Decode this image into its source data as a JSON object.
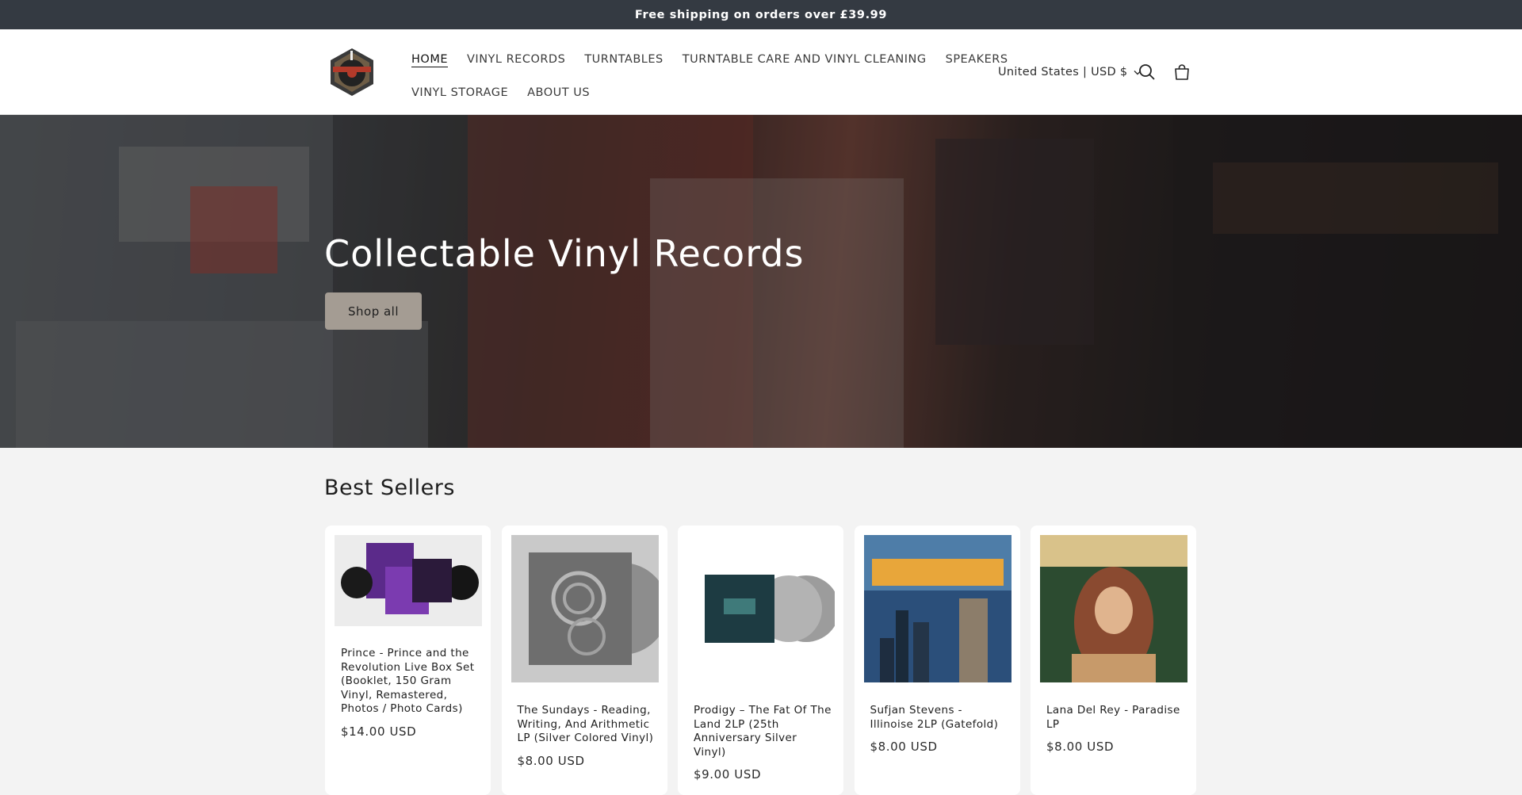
{
  "announcement": {
    "text": "Free shipping on orders over £39.99"
  },
  "header": {
    "logo_name": "Vinyl Collectors logo",
    "nav_row1": [
      {
        "label": "HOME",
        "active": true
      },
      {
        "label": "VINYL RECORDS"
      },
      {
        "label": "TURNTABLES"
      },
      {
        "label": "TURNTABLE CARE AND VINYL CLEANING"
      },
      {
        "label": "SPEAKERS"
      }
    ],
    "nav_row2": [
      {
        "label": "VINYL STORAGE"
      },
      {
        "label": "ABOUT US"
      }
    ],
    "locale": "United States | USD $",
    "icons": [
      "search-icon",
      "cart-icon",
      "chevron-down-icon"
    ]
  },
  "hero": {
    "title": "Collectable Vinyl Records",
    "button": "Shop all"
  },
  "best_sellers": {
    "title": "Best Sellers",
    "products": [
      {
        "title": "Prince - Prince and the Revolution Live Box Set (Booklet, 150 Gram Vinyl, Remastered, Photos / Photo Cards)",
        "price": "$14.00 USD"
      },
      {
        "title": "The Sundays - Reading, Writing, And Arithmetic LP (Silver Colored Vinyl)",
        "price": "$8.00 USD"
      },
      {
        "title": "Prodigy – The Fat Of The Land 2LP (25th Anniversary Silver Vinyl)",
        "price": "$9.00 USD"
      },
      {
        "title": "Sufjan Stevens - Illinoise 2LP (Gatefold)",
        "price": "$8.00 USD"
      },
      {
        "title": "Lana Del Rey - Paradise LP",
        "price": "$8.00 USD"
      }
    ]
  },
  "colors": {
    "announcement_bg": "#343a42",
    "button_bg": "#a49c93",
    "page_bg": "#f3f3f3"
  }
}
